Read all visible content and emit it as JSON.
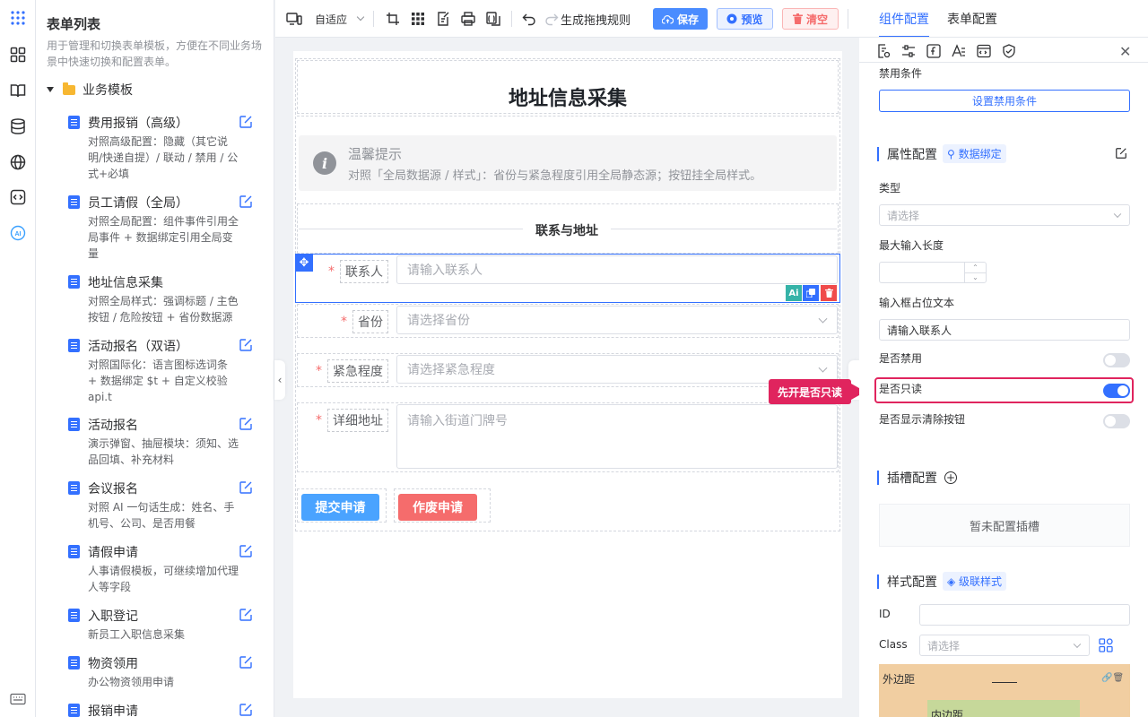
{
  "sidebar": {
    "title": "表单列表",
    "description": "用于管理和切换表单模板，方便在不同业务场景中快速切换和配置表单。",
    "group": "业务模板",
    "templates": [
      {
        "name": "费用报销（高级）",
        "desc": "对照高级配置：隐藏（其它说明/快递自提）/ 联动 / 禁用 / 公式+必填"
      },
      {
        "name": "员工请假（全局）",
        "desc": "对照全局配置：组件事件引用全局事件 + 数据绑定引用全局变量"
      },
      {
        "name": "地址信息采集",
        "desc": "对照全局样式：强调标题 / 主色按钮 / 危险按钮 + 省份数据源"
      },
      {
        "name": "活动报名（双语）",
        "desc": "对照国际化：语言图标选词条 + 数据绑定 $t + 自定义校验 api.t"
      },
      {
        "name": "活动报名",
        "desc": "演示弹窗、抽屉模块：须知、选品回填、补充材料"
      },
      {
        "name": "会议报名",
        "desc": "对照 AI 一句话生成：姓名、手机号、公司、是否用餐"
      },
      {
        "name": "请假申请",
        "desc": "人事请假模板，可继续增加代理人等字段"
      },
      {
        "name": "入职登记",
        "desc": "新员工入职信息采集"
      },
      {
        "name": "物资领用",
        "desc": "办公物资领用申请"
      },
      {
        "name": "报销申请",
        "desc": ""
      }
    ]
  },
  "toolbar": {
    "zoom": "自适应",
    "rules_label": "生成拖拽规则",
    "save": "保存",
    "preview": "预览",
    "clear": "清空"
  },
  "form": {
    "title": "地址信息采集",
    "alert_title": "温馨提示",
    "alert_desc": "对照「全局数据源 / 样式」：省份与紧急程度引用全局静态源；按钮挂全局样式。",
    "section": "联系与地址",
    "fields": [
      {
        "label": "联系人",
        "placeholder": "请输入联系人"
      },
      {
        "label": "省份",
        "placeholder": "请选择省份"
      },
      {
        "label": "紧急程度",
        "placeholder": "请选择紧急程度"
      },
      {
        "label": "详细地址",
        "placeholder": "请输入街道门牌号"
      }
    ],
    "submit": "提交申请",
    "void": "作废申请"
  },
  "panel": {
    "tab_component": "组件配置",
    "tab_form": "表单配置",
    "disable_cond_label": "禁用条件",
    "disable_cond_btn": "设置禁用条件",
    "attr_title": "属性配置",
    "attr_chip": "数据绑定",
    "type_label": "类型",
    "type_placeholder": "请选择",
    "maxlen_label": "最大输入长度",
    "placeholder_label": "输入框占位文本",
    "placeholder_value": "请输入联系人",
    "disabled_label": "是否禁用",
    "readonly_label": "是否只读",
    "clear_label": "是否显示清除按钮",
    "slot_title": "插槽配置",
    "slot_empty": "暂未配置插槽",
    "style_title": "样式配置",
    "style_chip": "级联样式",
    "id_label": "ID",
    "class_label": "Class",
    "class_placeholder": "请选择",
    "margin_label": "外边距",
    "padding_label": "内边距"
  },
  "callout": "先开是否只读",
  "colors": {
    "primary": "#3370ff",
    "danger": "#f56c6c",
    "submit": "#4aa3ff",
    "highlight": "#e0245e"
  }
}
